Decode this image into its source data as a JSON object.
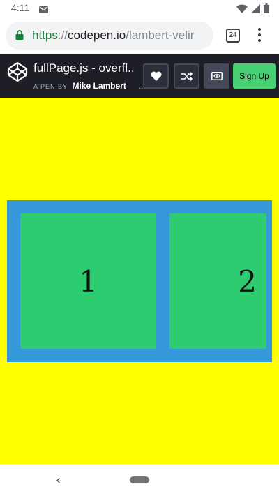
{
  "status_bar": {
    "time": "4:11",
    "icons": [
      "gmail-icon",
      "wifi-icon",
      "signal-icon",
      "battery-icon"
    ]
  },
  "browser": {
    "url_scheme": "https",
    "url_separator": "://",
    "url_host": "codepen.io",
    "url_path": "/lambert-velir",
    "tab_count": "24"
  },
  "codepen": {
    "pen_title": "fullPage.js - overfl...",
    "pen_by": "A PEN BY",
    "author": "Mike Lambert",
    "more": "...",
    "signup_label": "Sign Up",
    "brand_color": "#47cf73"
  },
  "preview": {
    "background": "#ffff00",
    "container_color": "#3498db",
    "slide_color": "#2ecc71",
    "slides": [
      "1",
      "2"
    ]
  }
}
